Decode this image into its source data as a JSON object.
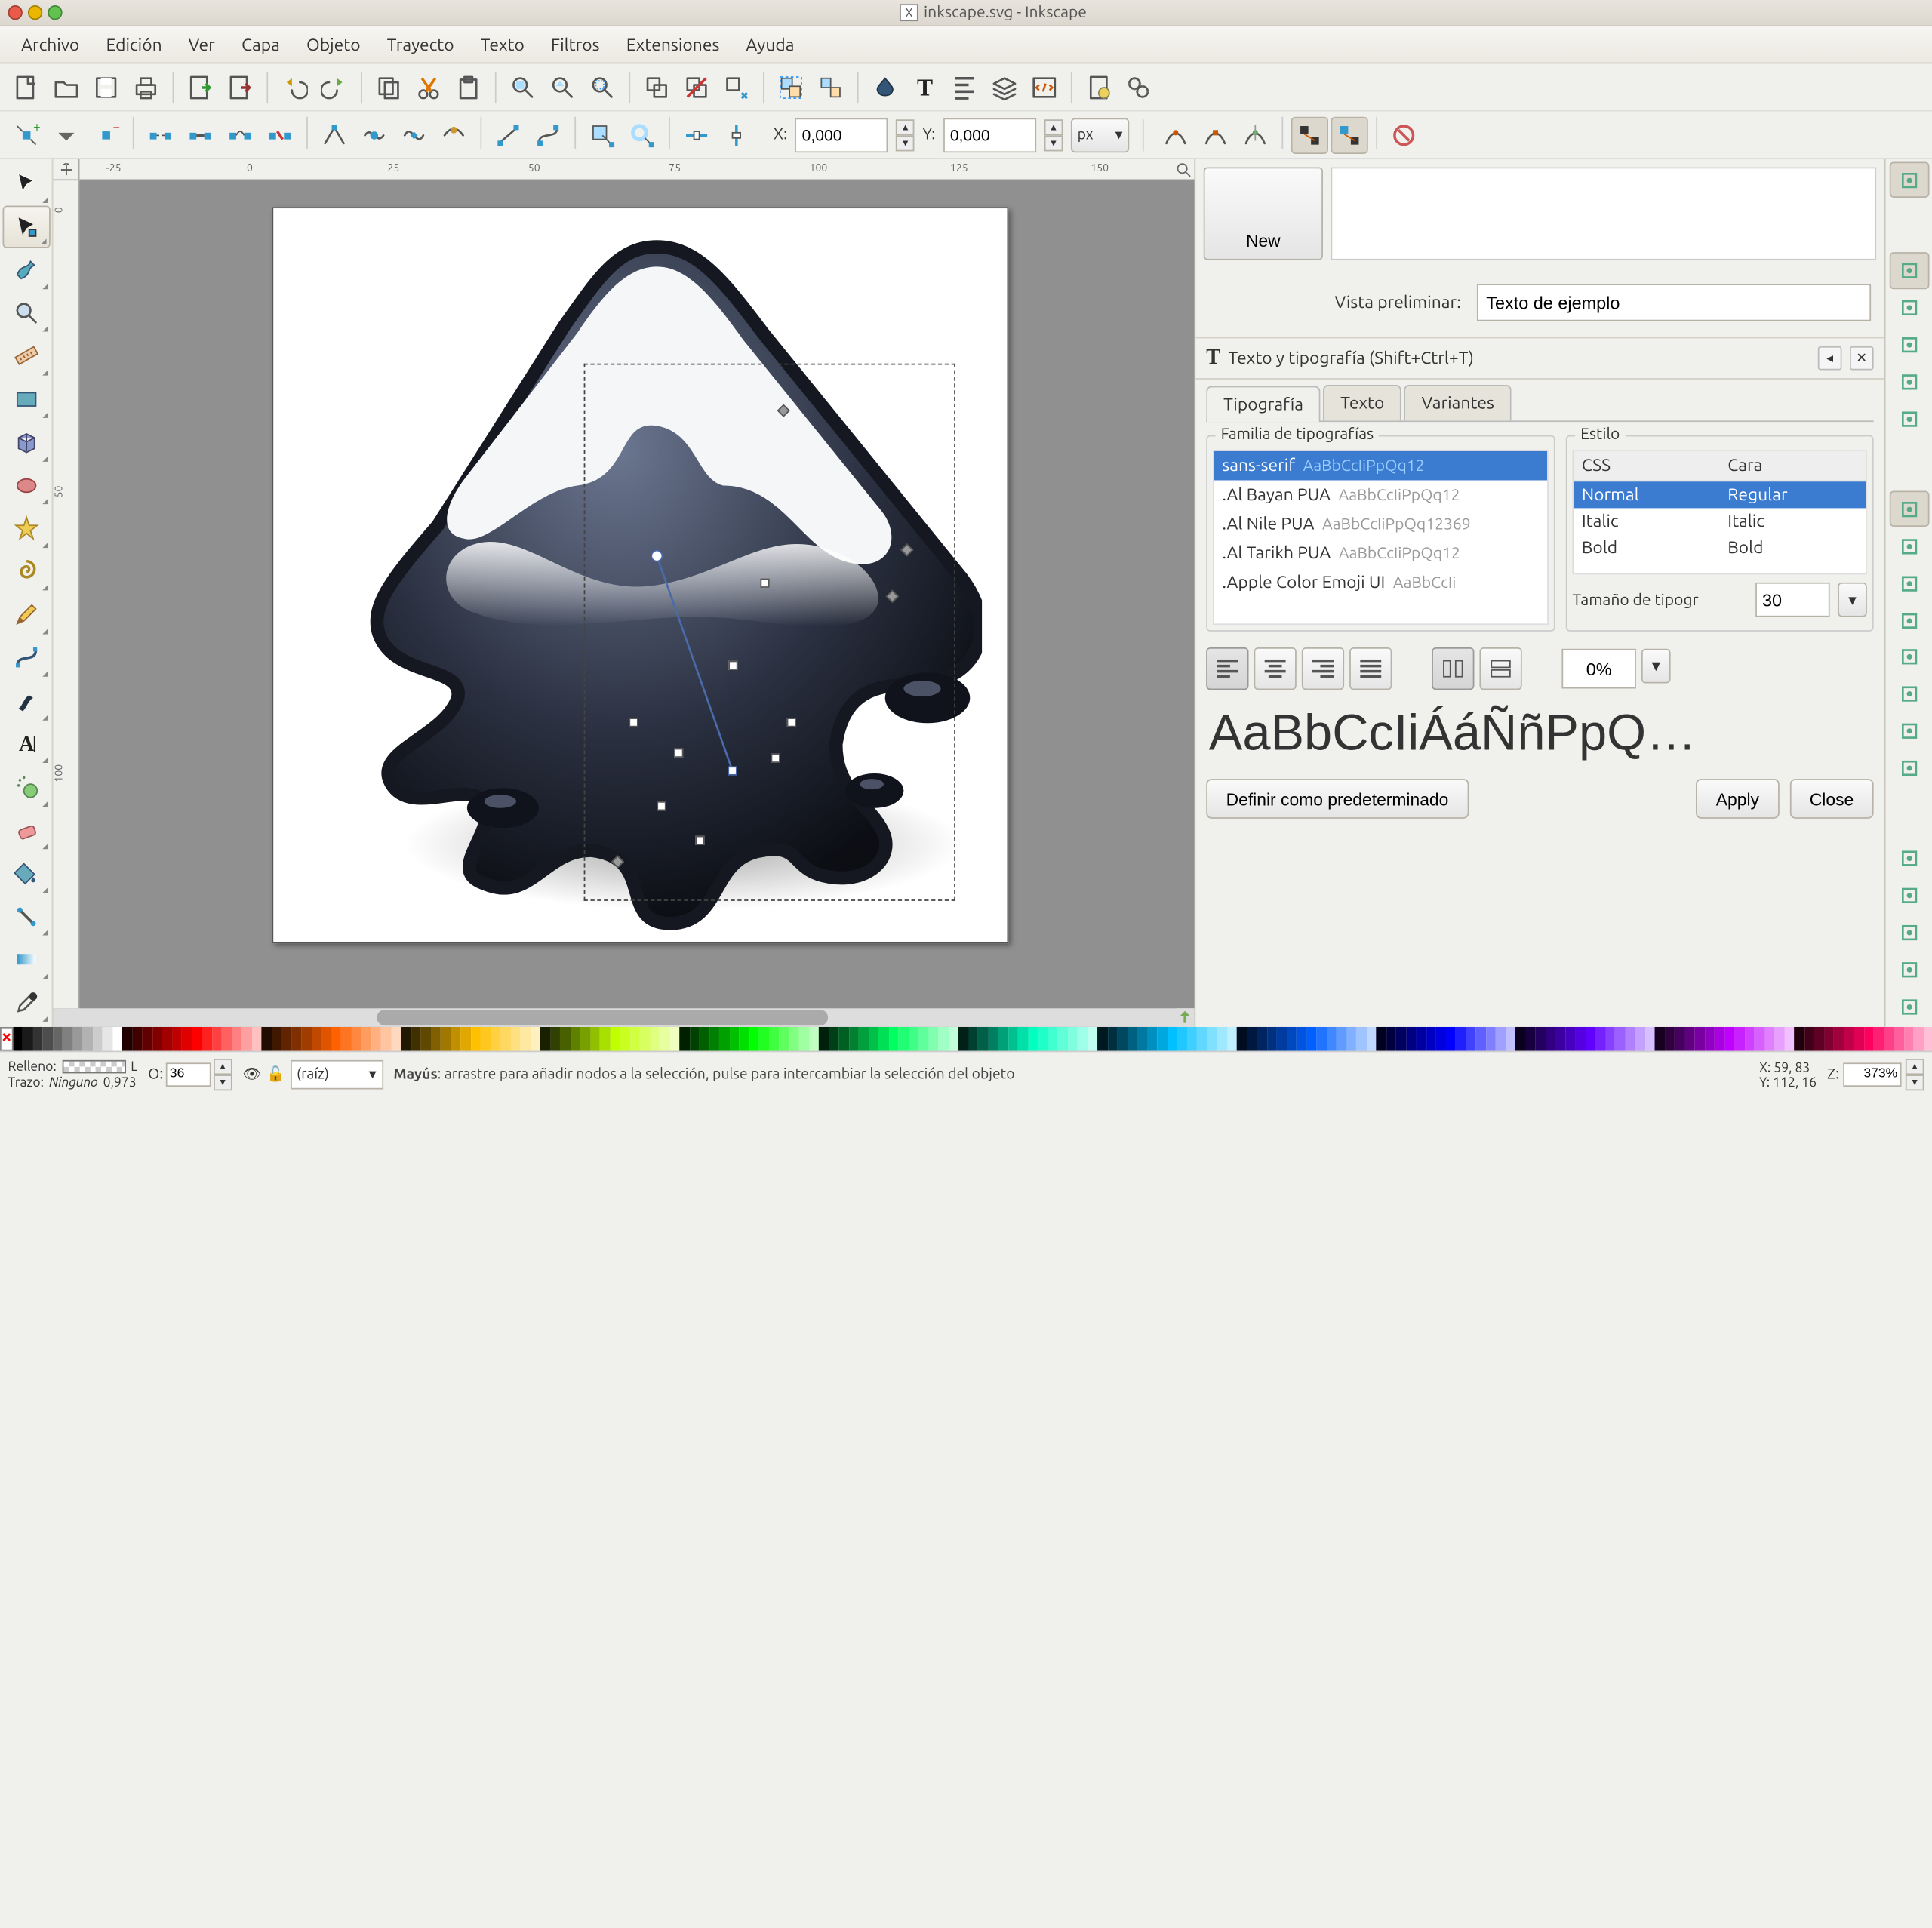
{
  "window": {
    "title": "inkscape.svg - Inkscape",
    "icon_label": "X"
  },
  "menu": [
    "Archivo",
    "Edición",
    "Ver",
    "Capa",
    "Objeto",
    "Trayecto",
    "Texto",
    "Filtros",
    "Extensiones",
    "Ayuda"
  ],
  "toolbar_main": [
    "new",
    "open",
    "save",
    "print",
    "|",
    "import",
    "export",
    "|",
    "undo",
    "redo",
    "|",
    "copy",
    "cut",
    "paste",
    "|",
    "zoom-page",
    "zoom-drawing",
    "zoom-selection",
    "|",
    "clone",
    "unlink",
    "select-original",
    "|",
    "group",
    "ungroup",
    "|",
    "fill-stroke",
    "text-tool",
    "align",
    "layers",
    "xml",
    "|",
    "document-properties",
    "preferences"
  ],
  "coordbar": {
    "btns_left": [
      "add-node",
      "node-menu",
      "remove-node",
      "|",
      "break",
      "join",
      "join-seg",
      "del-seg",
      "|",
      "cusp",
      "smooth",
      "symm",
      "auto",
      "|",
      "line",
      "curve",
      "|",
      "object-to-path",
      "stroke-to-path",
      "|",
      "ax",
      "ay"
    ],
    "xlabel": "X:",
    "x": "0,000",
    "ylabel": "Y:",
    "y": "0,000",
    "unit": "px",
    "btns_right": [
      "snap-a",
      "snap-b",
      "snap-c",
      "|",
      "next-a",
      "next-b",
      "|",
      "shape-c"
    ]
  },
  "ruler_h": [
    "-25",
    "0",
    "25",
    "50",
    "75",
    "100",
    "125",
    "150"
  ],
  "ruler_v": [
    "0",
    "50",
    "100"
  ],
  "dock": {
    "new_btn": "New",
    "preview_label": "Vista preliminar:",
    "preview_value": "Texto de ejemplo",
    "panel_title": "Texto y tipografía (Shift+Ctrl+T)",
    "tabs": [
      "Tipografía",
      "Texto",
      "Variantes"
    ],
    "font_legend": "Familia de tipografías",
    "style_legend": "Estilo",
    "fonts": [
      {
        "name": "sans-serif",
        "sample": "AaBbCcIiPpQq12",
        "sel": true
      },
      {
        "name": ".Al Bayan PUA",
        "sample": "AaBbCcIiPpQq12"
      },
      {
        "name": ".Al Nile PUA",
        "sample": "AaBbCcIiPpQq12369"
      },
      {
        "name": ".Al Tarikh PUA",
        "sample": "AaBbCcIiPpQq12"
      },
      {
        "name": ".Apple Color Emoji UI",
        "sample": "AaBbCcIi"
      }
    ],
    "style_cols": [
      "CSS",
      "Cara"
    ],
    "styles": [
      {
        "css": "Normal",
        "cara": "Regular",
        "sel": true
      },
      {
        "css": "Italic",
        "cara": "Italic"
      },
      {
        "css": "Bold",
        "cara": "Bold"
      }
    ],
    "size_label": "Tamaño de tipogr",
    "size": "30",
    "spacing": "0%",
    "preview_text": "AaBbCcIiÁáÑñPpQ…",
    "default_btn": "Definir como predeterminado",
    "apply": "Apply",
    "close": "Close"
  },
  "palette_colors": [
    "#000000",
    "#1a1a1a",
    "#333333",
    "#4d4d4d",
    "#666666",
    "#808080",
    "#999999",
    "#b2b2b2",
    "#cccccc",
    "#e6e6e6",
    "#ffffff",
    "#200000",
    "#400000",
    "#600000",
    "#800000",
    "#a00000",
    "#c00000",
    "#e00000",
    "#ff0000",
    "#ff2020",
    "#ff4040",
    "#ff6060",
    "#ff8080",
    "#ffa0a0",
    "#ffc0c0",
    "#200c00",
    "#401800",
    "#602400",
    "#803000",
    "#a03c00",
    "#c04800",
    "#e05400",
    "#ff6000",
    "#ff7420",
    "#ff8840",
    "#ff9c60",
    "#ffb080",
    "#ffc4a0",
    "#ffd8c0",
    "#201800",
    "#403000",
    "#604800",
    "#806000",
    "#a07800",
    "#c09000",
    "#e0a800",
    "#ffc000",
    "#ffc820",
    "#ffd040",
    "#ffd860",
    "#ffe080",
    "#ffe8a0",
    "#fff0c0",
    "#182000",
    "#304000",
    "#486000",
    "#608000",
    "#78a000",
    "#90c000",
    "#a8e000",
    "#c0ff00",
    "#c8ff20",
    "#d0ff40",
    "#d8ff60",
    "#e0ff80",
    "#e8ffa0",
    "#f0ffc0",
    "#002000",
    "#004000",
    "#006000",
    "#008000",
    "#00a000",
    "#00c000",
    "#00e000",
    "#00ff00",
    "#20ff20",
    "#40ff40",
    "#60ff60",
    "#80ff80",
    "#a0ffa0",
    "#c0ffc0",
    "#00200c",
    "#004018",
    "#006024",
    "#008030",
    "#00a03c",
    "#00c048",
    "#00e054",
    "#00ff60",
    "#20ff74",
    "#40ff88",
    "#60ff9c",
    "#80ffb0",
    "#a0ffc4",
    "#c0ffd8",
    "#002018",
    "#004030",
    "#006048",
    "#008060",
    "#00a078",
    "#00c090",
    "#00e0a8",
    "#00ffc0",
    "#20ffc8",
    "#40ffd0",
    "#60ffd8",
    "#80ffe0",
    "#a0ffe8",
    "#c0fff0",
    "#001820",
    "#003040",
    "#004860",
    "#006080",
    "#0078a0",
    "#0090c0",
    "#00a8e0",
    "#00c0ff",
    "#20c8ff",
    "#40d0ff",
    "#60d8ff",
    "#80e0ff",
    "#a0e8ff",
    "#c0f0ff",
    "#000c20",
    "#001840",
    "#002460",
    "#003080",
    "#003ca0",
    "#0048c0",
    "#0054e0",
    "#0060ff",
    "#2074ff",
    "#4088ff",
    "#609cff",
    "#80b0ff",
    "#a0c4ff",
    "#c0d8ff",
    "#000020",
    "#000040",
    "#000060",
    "#000080",
    "#0000a0",
    "#0000c0",
    "#0000e0",
    "#0000ff",
    "#2020ff",
    "#4040ff",
    "#6060ff",
    "#8080ff",
    "#a0a0ff",
    "#c0c0ff",
    "#0c0020",
    "#180040",
    "#240060",
    "#300080",
    "#3c00a0",
    "#4800c0",
    "#5400e0",
    "#6000ff",
    "#7420ff",
    "#8840ff",
    "#9c60ff",
    "#b080ff",
    "#c4a0ff",
    "#d8c0ff",
    "#180020",
    "#300040",
    "#480060",
    "#600080",
    "#7800a0",
    "#9000c0",
    "#a800e0",
    "#c000ff",
    "#c820ff",
    "#d040ff",
    "#d860ff",
    "#e080ff",
    "#e8a0ff",
    "#f0c0ff",
    "#20000c",
    "#400018",
    "#600024",
    "#800030",
    "#a0003c",
    "#c00048",
    "#e00054",
    "#ff0060",
    "#ff2074",
    "#ff4088",
    "#ff609c",
    "#ff80b0",
    "#ffa0c4",
    "#ffc0d8"
  ],
  "status": {
    "fill_label": "Relleno:",
    "fill_value": "L",
    "stroke_label": "Trazo:",
    "stroke_value": "Ninguno",
    "stroke_w": "0,973",
    "opacity_label": "O:",
    "opacity": "36",
    "layer": "(raíz)",
    "hint_bold": "Mayús",
    "hint_rest": ": arrastre para añadir nodos a la selección, pulse para intercambiar la selección del objeto",
    "x_label": "X:",
    "x": "59, 83",
    "y_label": "Y:",
    "y": "112, 16",
    "z_label": "Z:",
    "zoom": "373%"
  },
  "tools": [
    "select",
    "node",
    "tweak",
    "zoom",
    "measure",
    "rect",
    "3dbox",
    "circle",
    "star",
    "spiral",
    "pencil",
    "bezier",
    "calligraphy",
    "text",
    "spray",
    "eraser",
    "fill",
    "connector",
    "gradient",
    "dropper"
  ],
  "snap": [
    "snap-toggle",
    "|",
    "snap-bbox",
    "snap-bbox-edge",
    "snap-bbox-corner",
    "snap-edge-mid",
    "snap-bbox-center",
    "|",
    "snap-node",
    "snap-path",
    "snap-intersect",
    "snap-cusp",
    "snap-smooth",
    "snap-line-mid",
    "snap-object-center",
    "snap-rot-center",
    "|",
    "snap-other",
    "snap-center",
    "snap-text",
    "snap-grid",
    "snap-guide"
  ]
}
